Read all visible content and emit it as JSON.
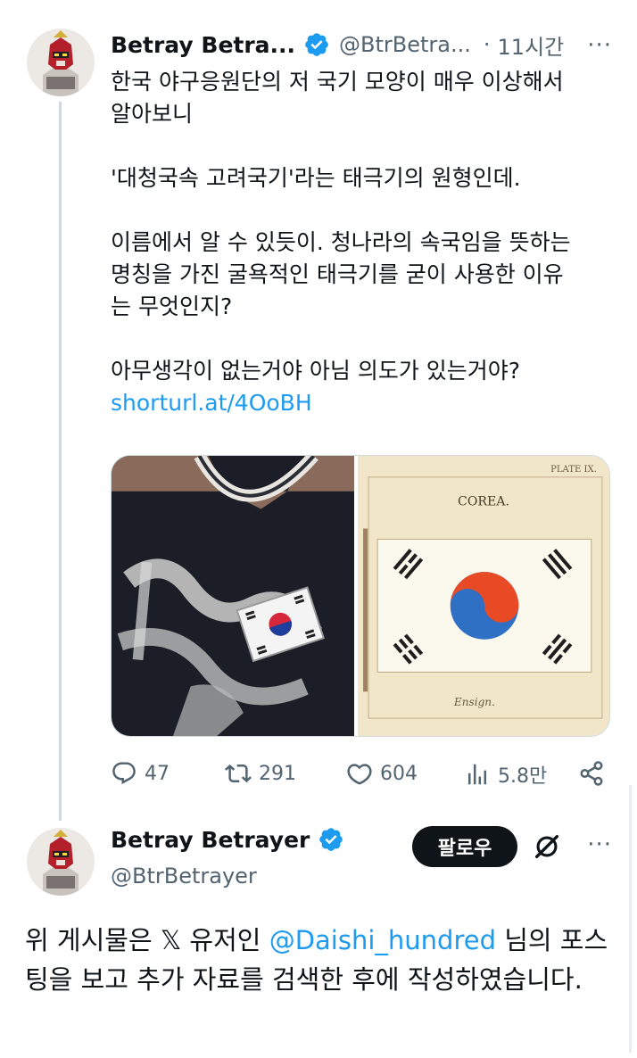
{
  "tweet": {
    "author_name": "Betray Betra...",
    "handle": "@BtrBetra...",
    "dot": "·",
    "time": "11시간",
    "more": "···",
    "lines": [
      "한국 야구응원단의 저 국기 모양이 매우 이상해서",
      "알아보니",
      "",
      "'대청국속 고려국기'라는 태극기의 원형인데.",
      "",
      "이름에서 알 수 있듯이. 청나라의 속국임을 뜻하는",
      "명칭을 가진 굴욕적인 태극기를 굳이 사용한 이유",
      "는 무엇인지?",
      "",
      "아무생각이 없는거야 아님 의도가 있는거야?"
    ],
    "link": "shorturl.at/4OoBH",
    "media": {
      "plate_label": "PLATE IX.",
      "country_label": "COREA.",
      "caption": "Ensign."
    },
    "stats": {
      "replies": "47",
      "reposts": "291",
      "likes": "604",
      "views": "5.8만"
    }
  },
  "reply": {
    "author_name": "Betray Betrayer",
    "handle": "@BtrBetrayer",
    "follow_label": "팔로우",
    "more": "···",
    "text_before": "위 게시물은 𝕏 유저인 ",
    "mention": "@Daishi_hundred",
    "text_after": " 님의 포스팅을 보고 추가 자료를 검색한 후에 작성하였습니다."
  },
  "icons": {
    "verified": "verified-badge-icon",
    "reply": "reply-icon",
    "repost": "repost-icon",
    "like": "heart-icon",
    "views": "views-bar-icon",
    "share": "share-icon",
    "grok": "grok-icon"
  },
  "colors": {
    "accent": "#1d9bf0",
    "text": "#0f1419",
    "muted": "#536471"
  }
}
